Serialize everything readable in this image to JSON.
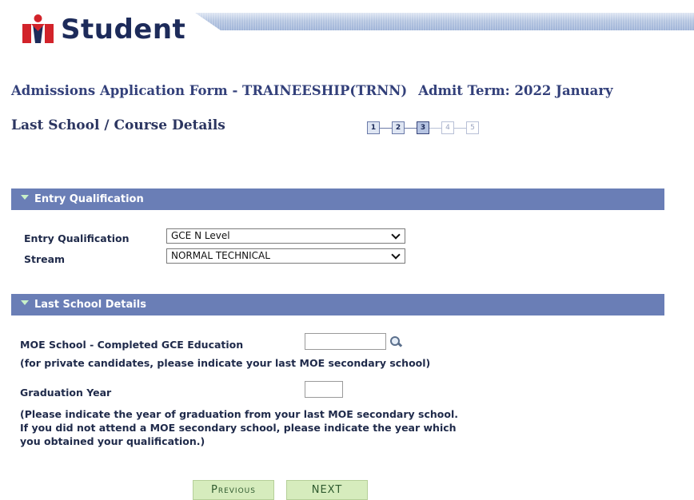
{
  "header": {
    "logo_text": "Student",
    "logo_colors": {
      "red": "#d2232a",
      "navy": "#1d2b5a"
    }
  },
  "form": {
    "title": "Admissions Application Form - TRAINEESHIP(TRNN)",
    "admit_term": "Admit Term: 2022 January",
    "page_title": "Last School / Course Details"
  },
  "steps": [
    {
      "label": "1",
      "state": "done"
    },
    {
      "label": "2",
      "state": "done"
    },
    {
      "label": "3",
      "state": "current"
    },
    {
      "label": "4",
      "state": "future"
    },
    {
      "label": "5",
      "state": "future"
    }
  ],
  "entry_qualification": {
    "section_title": "Entry Qualification",
    "qualification_label": "Entry Qualification",
    "qualification_value": "GCE N Level",
    "stream_label": "Stream",
    "stream_value": "NORMAL TECHNICAL"
  },
  "last_school": {
    "section_title": "Last School Details",
    "school_label": "MOE School - Completed GCE Education",
    "school_value": "",
    "school_note": "(for private candidates, please indicate your last MOE secondary school)",
    "grad_label": "Graduation Year",
    "grad_value": "",
    "grad_note_1": "(Please indicate the year of graduation from your last MOE secondary school.",
    "grad_note_2": "If you did not attend a MOE secondary school, please indicate the year which",
    "grad_note_3": "you obtained your qualification.)"
  },
  "buttons": {
    "previous": "Previous",
    "next": "NEXT"
  },
  "colors": {
    "section_bar": "#6a7eb6",
    "button_bg": "#d6ecbd",
    "title_text": "#33407a"
  }
}
